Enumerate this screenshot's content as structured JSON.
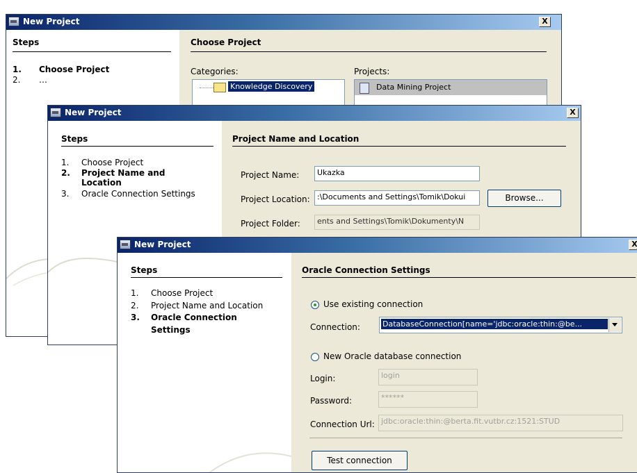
{
  "dialog1": {
    "title": "New Project",
    "close": "X",
    "steps_header": "Steps",
    "steps": [
      {
        "num": "1.",
        "label": "Choose Project"
      },
      {
        "num": "2.",
        "label": "…"
      }
    ],
    "content_header": "Choose Project",
    "categories_label": "Categories:",
    "projects_label": "Projects:",
    "category_item": "Knowledge Discovery",
    "project_item": "Data Mining Project"
  },
  "dialog2": {
    "title": "New Project",
    "close": "X",
    "steps_header": "Steps",
    "steps": [
      {
        "num": "1.",
        "label": "Choose Project"
      },
      {
        "num": "2.",
        "label": "Project Name and"
      },
      {
        "num": "",
        "label": "Location"
      },
      {
        "num": "3.",
        "label": "Oracle Connection Settings"
      }
    ],
    "content_header": "Project Name and Location",
    "project_name_label": "Project Name:",
    "project_name_value": "Ukazka",
    "project_location_label": "Project Location:",
    "project_location_value": ":\\Documents and Settings\\Tomik\\Dokui",
    "browse_button": "Browse...",
    "project_folder_label": "Project Folder:",
    "project_folder_value": "ents and Settings\\Tomik\\Dokumenty\\N"
  },
  "dialog3": {
    "title": "New Project",
    "close": "X",
    "steps_header": "Steps",
    "steps": [
      {
        "num": "1.",
        "label": "Choose Project"
      },
      {
        "num": "2.",
        "label": "Project Name and Location"
      },
      {
        "num": "3.",
        "label": "Oracle Connection"
      },
      {
        "num": "",
        "label": "Settings"
      }
    ],
    "content_header": "Oracle Connection Settings",
    "use_existing_label": "Use existing connection",
    "connection_label": "Connection:",
    "connection_value": "DatabaseConnection[name='jdbc:oracle:thin:@be...",
    "new_connection_label": "New Oracle database connection",
    "login_label": "Login:",
    "login_value": "login",
    "password_label": "Password:",
    "password_value": "******",
    "url_label": "Connection Url:",
    "url_value": "jdbc:oracle:thin:@berta.fit.vutbr.cz:1521:STUD",
    "test_button": "Test connection"
  },
  "colors": {
    "title_gradient_start": "#0a246a",
    "title_gradient_end": "#a6caf0",
    "dialog_face": "#ece9d8",
    "selection": "#0a246a"
  }
}
